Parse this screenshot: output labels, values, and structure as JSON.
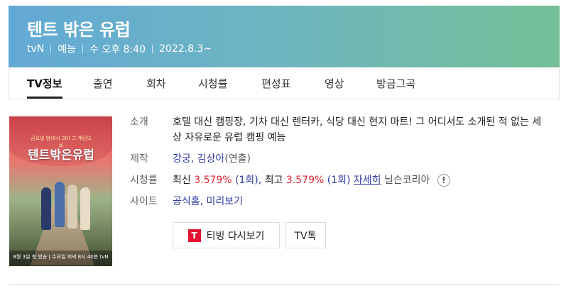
{
  "program": {
    "title": "텐트 밖은 유럽",
    "channel": "tvN",
    "genre": "예능",
    "airtime": "수 오후 8:40",
    "start_date": "2022.8.3~"
  },
  "tabs": [
    {
      "label": "TV정보",
      "active": true
    },
    {
      "label": "출연"
    },
    {
      "label": "회차"
    },
    {
      "label": "시청률"
    },
    {
      "label": "편성표"
    },
    {
      "label": "영상"
    },
    {
      "label": "방금그곡"
    }
  ],
  "poster": {
    "title_text": "텐트밖은유럽",
    "sub_text": "금요일 밤(8시 30) 그 계단으로",
    "footer_text": "8월 3일 첫 방송 | 수요일 저녁 8시 40분 tvN"
  },
  "details": {
    "intro_label": "소개",
    "intro_text": "호텔 대신 캠핑장, 기차 대신 렌터카, 식당 대신 현지 마트! 그 어디서도 소개된 적 없는 세상 자유로운 유럽 캠핑 예능",
    "production_label": "제작",
    "production_names": "강궁, 김상아",
    "production_role": "(연출)",
    "ratings_label": "시청률",
    "ratings_latest_label": "최신",
    "ratings_latest_value": "3.579%",
    "ratings_latest_ep": "(1회),",
    "ratings_best_label": "최고",
    "ratings_best_value": "3.579%",
    "ratings_best_ep": "(1회)",
    "ratings_more": "자세히",
    "ratings_source": "닐슨코리아",
    "info_icon": "!",
    "site_label": "사이트",
    "site_home": "공식홈",
    "site_sep": ",",
    "site_preview": "미리보기"
  },
  "buttons": {
    "tving_icon_text": "T",
    "tving_label": "티빙 다시보기",
    "tvtalk_label": "TV톡"
  },
  "colors": {
    "header_start": "#63a9d6",
    "header_end": "#75bf98",
    "highlight_red": "#e1242c",
    "link_navy": "#2c3aa0",
    "tving_red": "#e3122f"
  }
}
